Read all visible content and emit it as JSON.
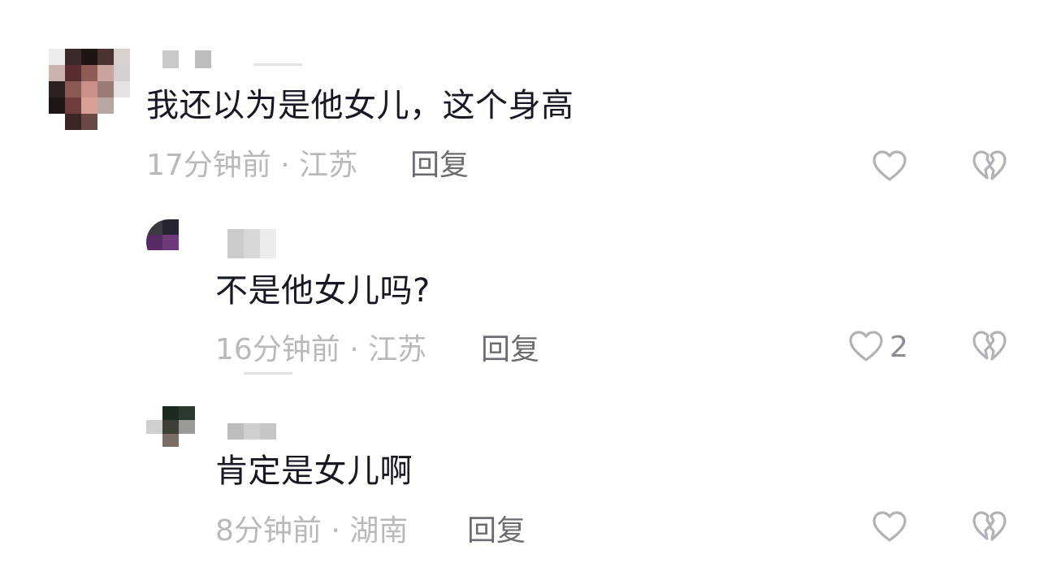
{
  "comments": [
    {
      "text": "我还以为是他女儿，这个身高",
      "time": "17分钟前",
      "dot": "·",
      "location": "江苏",
      "reply_label": "回复",
      "like_count": ""
    },
    {
      "text": "不是他女儿吗?",
      "time": "16分钟前",
      "dot": "·",
      "location": "江苏",
      "reply_label": "回复",
      "like_count": "2"
    },
    {
      "text": "肯定是女儿啊",
      "time": "8分钟前",
      "dot": "·",
      "location": "湖南",
      "reply_label": "回复",
      "like_count": ""
    }
  ],
  "icons": {
    "like": "heart-outline-icon",
    "dislike": "broken-heart-icon"
  },
  "colors": {
    "text": "#161823",
    "meta": "#b7b9bd",
    "reply": "#6b6d72",
    "icon": "#b0b2b6"
  }
}
